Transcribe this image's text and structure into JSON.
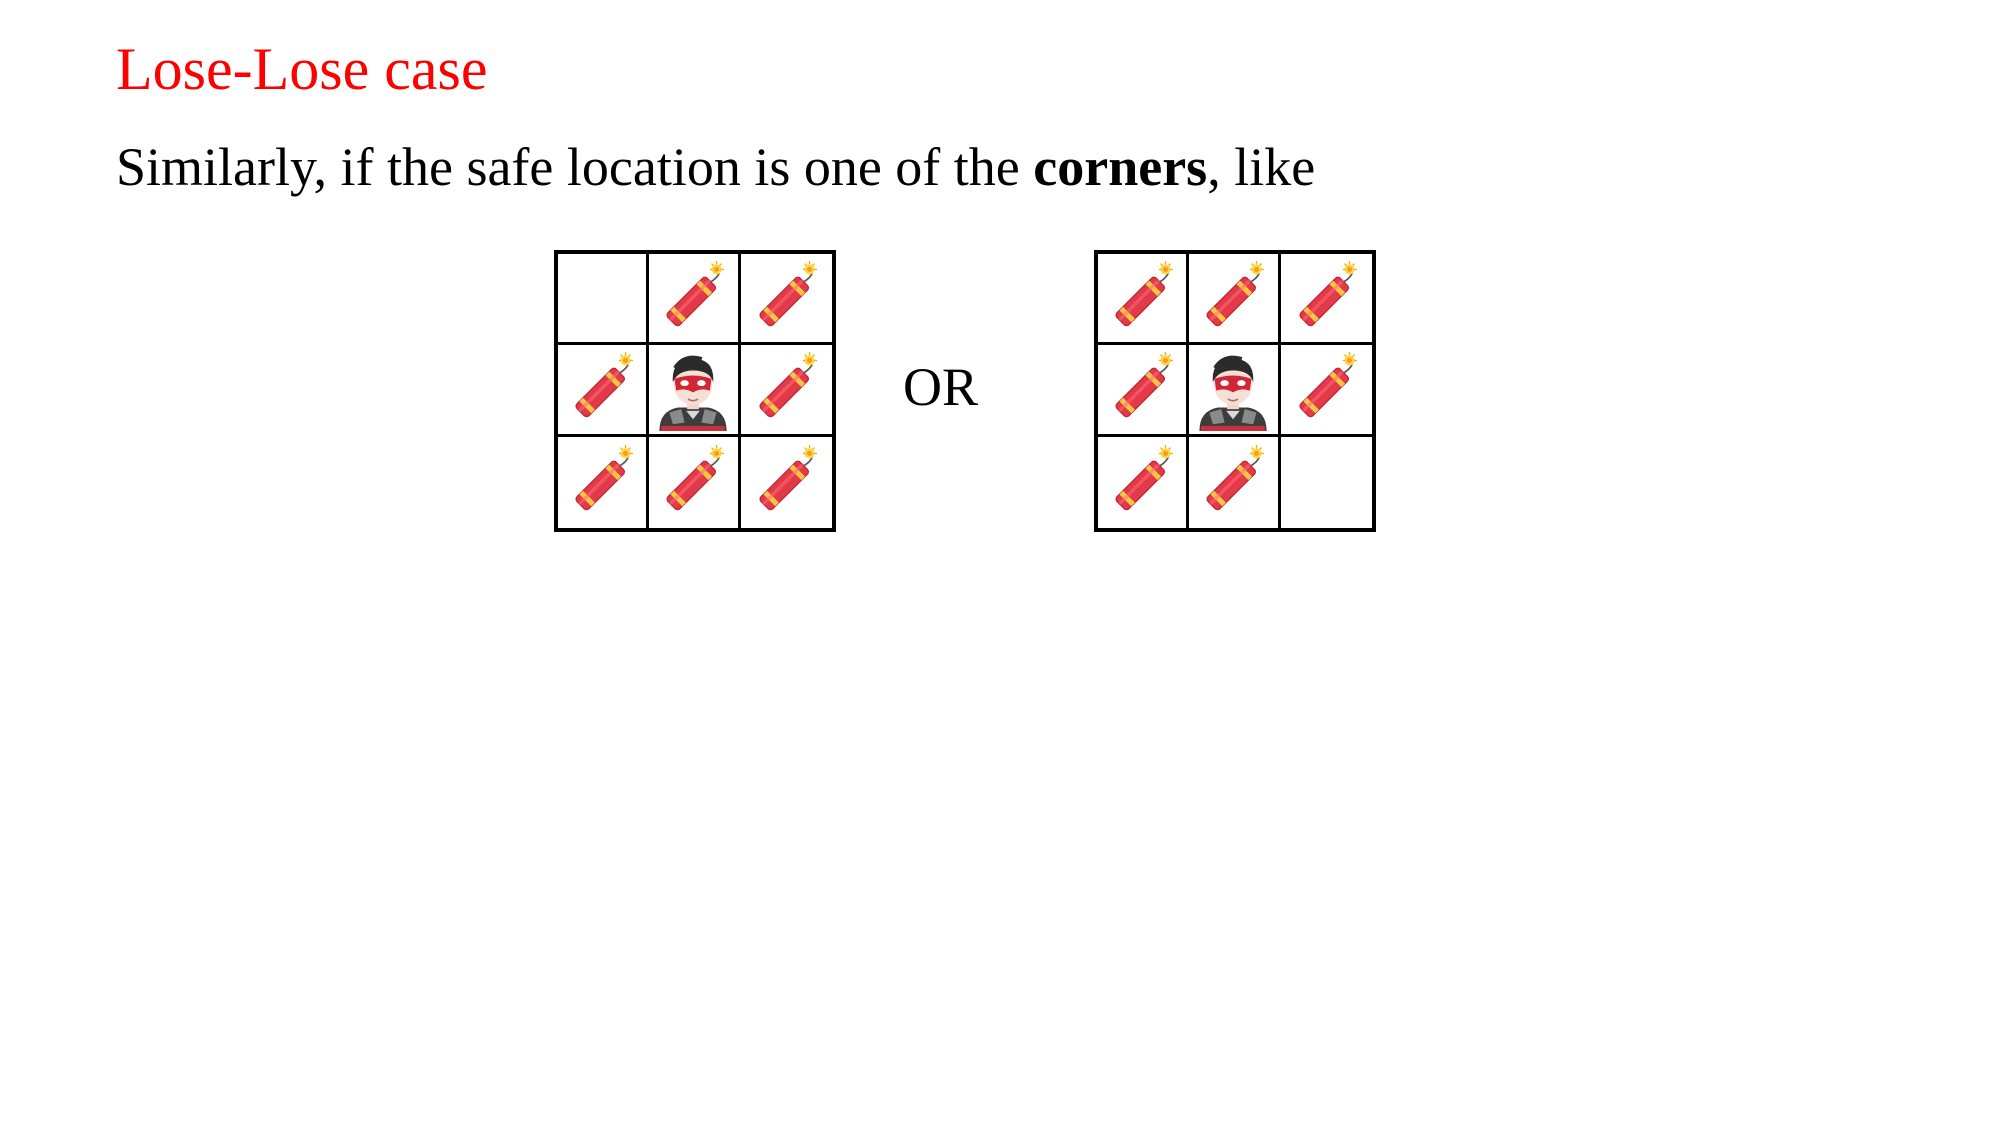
{
  "slide": {
    "title": "Lose-Lose case",
    "title_color": "#ff0000",
    "subtitle_prefix": "Similarly, if the safe location is one of the ",
    "subtitle_bold": "corners",
    "subtitle_suffix": ", like",
    "separator": "OR"
  },
  "icons": {
    "dynamite": "dynamite-icon",
    "hero": "masked-hero-icon",
    "empty": "safe-empty-cell"
  },
  "grids": [
    {
      "cells": [
        [
          "empty",
          "dynamite",
          "dynamite"
        ],
        [
          "dynamite",
          "hero",
          "dynamite"
        ],
        [
          "dynamite",
          "dynamite",
          "dynamite"
        ]
      ]
    },
    {
      "cells": [
        [
          "dynamite",
          "dynamite",
          "dynamite"
        ],
        [
          "dynamite",
          "hero",
          "dynamite"
        ],
        [
          "dynamite",
          "dynamite",
          "empty"
        ]
      ]
    }
  ]
}
